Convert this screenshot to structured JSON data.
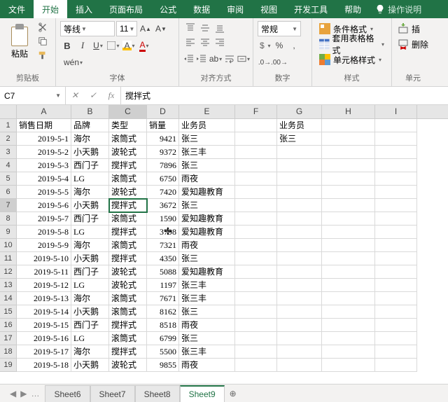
{
  "tabs": [
    "文件",
    "开始",
    "插入",
    "页面布局",
    "公式",
    "数据",
    "审阅",
    "视图",
    "开发工具",
    "帮助"
  ],
  "active_tab": "开始",
  "tell_me": "操作说明",
  "clipboard": {
    "paste": "粘贴",
    "group": "剪贴板"
  },
  "font": {
    "name": "等线",
    "size": "11",
    "group": "字体",
    "wen": "wén"
  },
  "align": {
    "group": "对齐方式"
  },
  "number": {
    "format": "常规",
    "group": "数字"
  },
  "styles": {
    "cond": "条件格式",
    "table": "套用表格格式",
    "cell": "单元格样式",
    "group": "样式"
  },
  "cells": {
    "insert": "插",
    "delete": "删除",
    "group": "单元"
  },
  "namebox": "C7",
  "formula": "搅拌式",
  "cols": [
    "A",
    "B",
    "C",
    "D",
    "E",
    "F",
    "G",
    "H",
    "I"
  ],
  "headers": {
    "A": "销售日期",
    "B": "品牌",
    "C": "类型",
    "D": "销量",
    "E": "业务员",
    "G": "业务员"
  },
  "g2": "张三",
  "rows": [
    {
      "n": 2,
      "a": "2019-5-1",
      "b": "海尔",
      "c": "滚筒式",
      "d": "9421",
      "e": "张三"
    },
    {
      "n": 3,
      "a": "2019-5-2",
      "b": "小天鹅",
      "c": "波轮式",
      "d": "9372",
      "e": "张三丰"
    },
    {
      "n": 4,
      "a": "2019-5-3",
      "b": "西门子",
      "c": "搅拌式",
      "d": "7896",
      "e": "张三"
    },
    {
      "n": 5,
      "a": "2019-5-4",
      "b": "LG",
      "c": "滚筒式",
      "d": "6750",
      "e": "雨夜"
    },
    {
      "n": 6,
      "a": "2019-5-5",
      "b": "海尔",
      "c": "波轮式",
      "d": "7420",
      "e": "爱知趣教育"
    },
    {
      "n": 7,
      "a": "2019-5-6",
      "b": "小天鹅",
      "c": "搅拌式",
      "d": "3672",
      "e": "张三"
    },
    {
      "n": 8,
      "a": "2019-5-7",
      "b": "西门子",
      "c": "滚筒式",
      "d": "1590",
      "e": "爱知趣教育"
    },
    {
      "n": 9,
      "a": "2019-5-8",
      "b": "LG",
      "c": "搅拌式",
      "d": "3798",
      "e": "爱知趣教育"
    },
    {
      "n": 10,
      "a": "2019-5-9",
      "b": "海尔",
      "c": "滚筒式",
      "d": "7321",
      "e": "雨夜"
    },
    {
      "n": 11,
      "a": "2019-5-10",
      "b": "小天鹅",
      "c": "搅拌式",
      "d": "4350",
      "e": "张三"
    },
    {
      "n": 12,
      "a": "2019-5-11",
      "b": "西门子",
      "c": "波轮式",
      "d": "5088",
      "e": "爱知趣教育"
    },
    {
      "n": 13,
      "a": "2019-5-12",
      "b": "LG",
      "c": "波轮式",
      "d": "1197",
      "e": "张三丰"
    },
    {
      "n": 14,
      "a": "2019-5-13",
      "b": "海尔",
      "c": "滚筒式",
      "d": "7671",
      "e": "张三丰"
    },
    {
      "n": 15,
      "a": "2019-5-14",
      "b": "小天鹅",
      "c": "滚筒式",
      "d": "8162",
      "e": "张三"
    },
    {
      "n": 16,
      "a": "2019-5-15",
      "b": "西门子",
      "c": "搅拌式",
      "d": "8518",
      "e": "雨夜"
    },
    {
      "n": 17,
      "a": "2019-5-16",
      "b": "LG",
      "c": "滚筒式",
      "d": "6799",
      "e": "张三"
    },
    {
      "n": 18,
      "a": "2019-5-17",
      "b": "海尔",
      "c": "搅拌式",
      "d": "5500",
      "e": "张三丰"
    },
    {
      "n": 19,
      "a": "2019-5-18",
      "b": "小天鹅",
      "c": "波轮式",
      "d": "9855",
      "e": "雨夜"
    }
  ],
  "sheets": [
    "Sheet6",
    "Sheet7",
    "Sheet8",
    "Sheet9"
  ],
  "active_sheet": "Sheet9",
  "selected_cell": "C7"
}
